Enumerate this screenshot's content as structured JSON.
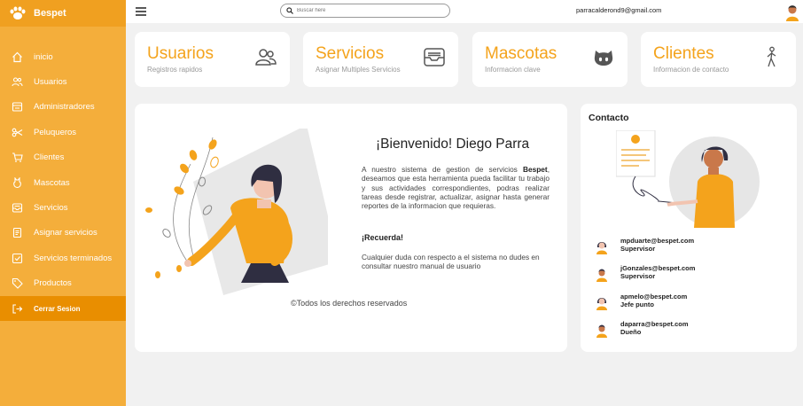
{
  "brand": {
    "name": "Bespet",
    "logo_icon": "paw-icon"
  },
  "sidebar": {
    "items": [
      {
        "label": "inicio",
        "icon": "home-icon"
      },
      {
        "label": "Usuarios",
        "icon": "users-icon"
      },
      {
        "label": "Administradores",
        "icon": "admin-icon"
      },
      {
        "label": "Peluqueros",
        "icon": "scissors-icon"
      },
      {
        "label": "Clientes",
        "icon": "cart-icon"
      },
      {
        "label": "Mascotas",
        "icon": "pet-icon"
      },
      {
        "label": "Servicios",
        "icon": "inbox-icon"
      },
      {
        "label": "Asignar servicios",
        "icon": "clipboard-icon"
      },
      {
        "label": "Servicios terminados",
        "icon": "check-square-icon"
      },
      {
        "label": "Productos",
        "icon": "tag-icon"
      },
      {
        "label": "Cerrar Sesion",
        "icon": "logout-icon",
        "active": true
      }
    ]
  },
  "topbar": {
    "search_placeholder": "Buscar here",
    "user_email": "parracalderond9@gmail.com"
  },
  "cards": [
    {
      "title": "Usuarios",
      "subtitle": "Registros rapidos",
      "icon": "users-icon"
    },
    {
      "title": "Servicios",
      "subtitle": "Asignar Multiples Servicios",
      "icon": "inbox-icon"
    },
    {
      "title": "Mascotas",
      "subtitle": "Informacion clave",
      "icon": "github-cat-icon"
    },
    {
      "title": "Clientes",
      "subtitle": "Informacion de contacto",
      "icon": "person-walking-icon"
    }
  ],
  "main": {
    "welcome": "¡Bienvenido! Diego Parra",
    "para_a": "A nuestro sistema de gestion de servicios ",
    "para_bold": "Bespet",
    "para_b": ", deseamos que esta herramienta pueda facilitar tu trabajo y sus actividades correspondientes, podras realizar tareas desde registrar, actualizar, asignar hasta generar reportes de la informacion que requieras.",
    "recuerda": "¡Recuerda!",
    "para2": "Cualquier duda con respecto a el sistema no dudes en consultar nuestro manual de usuario",
    "footer": "©Todos los derechos reservados"
  },
  "contact": {
    "title": "Contacto",
    "people": [
      {
        "email": "mpduarte@bespet.com",
        "role": "Supervisor",
        "avatar": "female"
      },
      {
        "email": "jGonzales@bespet.com",
        "role": "Supervisor",
        "avatar": "male"
      },
      {
        "email": "apmelo@bespet.com",
        "role": "Jefe punto",
        "avatar": "female"
      },
      {
        "email": "daparra@bespet.com",
        "role": "Dueño",
        "avatar": "male"
      }
    ]
  },
  "colors": {
    "accent": "#f4ae3b",
    "accent_dark": "#e98e00",
    "title_orange": "#f4a31c"
  }
}
